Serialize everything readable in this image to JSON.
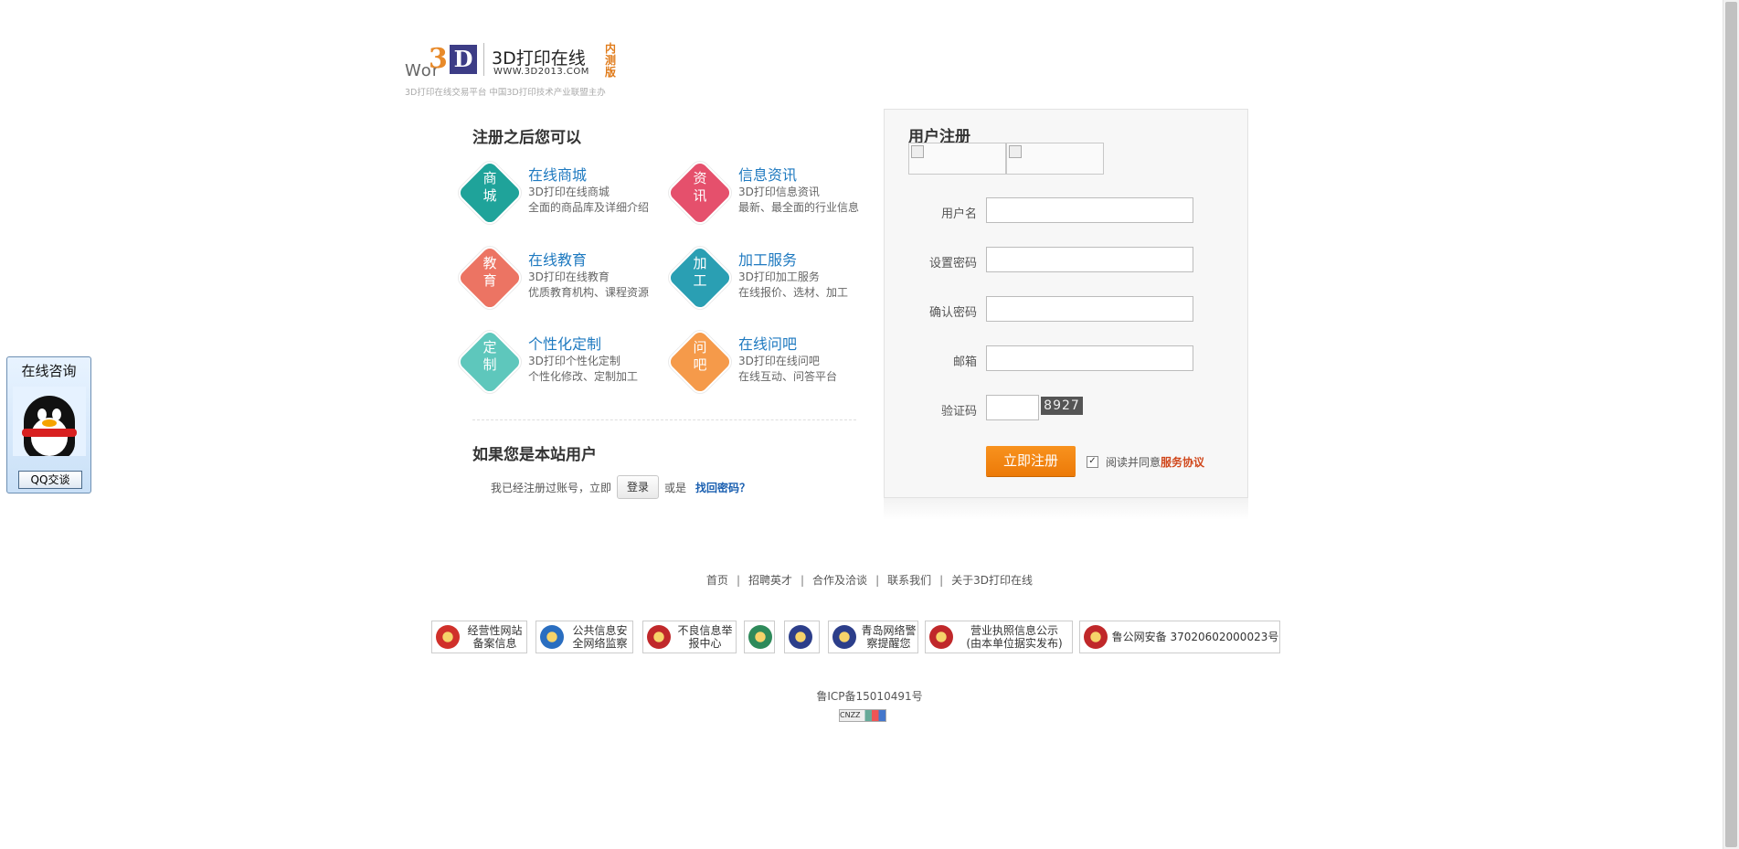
{
  "logo": {
    "wor_text": "Wor",
    "three": "3",
    "d_letter": "D",
    "name": "3D打印在线",
    "url": "WWW.3D2013.COM",
    "beta": "内测版",
    "tagline": "3D打印在线交易平台  中国3D打印技术产业联盟主办"
  },
  "benefits": {
    "title": "注册之后您可以",
    "items": [
      {
        "badge": "商城",
        "title": "在线商城",
        "line1": "3D打印在线商城",
        "line2": "全面的商品库及详细介绍",
        "color": "#1fa39a"
      },
      {
        "badge": "资讯",
        "title": "信息资讯",
        "line1": "3D打印信息资讯",
        "line2": "最新、最全面的行业信息",
        "color": "#e5506c"
      },
      {
        "badge": "教育",
        "title": "在线教育",
        "line1": "3D打印在线教育",
        "line2": "优质教育机构、课程资源",
        "color": "#ec7463"
      },
      {
        "badge": "加工",
        "title": "加工服务",
        "line1": "3D打印加工服务",
        "line2": "在线报价、选材、加工",
        "color": "#2a9fb3"
      },
      {
        "badge": "定制",
        "title": "个性化定制",
        "line1": "3D打印个性化定制",
        "line2": "个性化修改、定制加工",
        "color": "#5ec7bc"
      },
      {
        "badge": "问吧",
        "title": "在线问吧",
        "line1": "3D打印在线问吧",
        "line2": "在线互动、问答平台",
        "color": "#f59a4a"
      }
    ]
  },
  "existing_user": {
    "title": "如果您是本站用户",
    "prefix": "我已经注册过账号，立即",
    "login_button": "登录",
    "or": "或是",
    "forgot": "找回密码？"
  },
  "register": {
    "title": "用户注册",
    "fields": [
      {
        "label": "用户名",
        "value": ""
      },
      {
        "label": "设置密码",
        "value": ""
      },
      {
        "label": "确认密码",
        "value": ""
      },
      {
        "label": "邮箱",
        "value": ""
      }
    ],
    "captcha_label": "验证码",
    "captcha_value": "",
    "captcha_code": "8927",
    "submit": "立即注册",
    "agree_prefix": "阅读并同意",
    "agree_link": "服务协议",
    "agree_checked": true
  },
  "footer": {
    "links": [
      "首页",
      "招聘英才",
      "合作及洽谈",
      "联系我们",
      "关于3D打印在线"
    ],
    "separator": "|",
    "badges": [
      {
        "text": "经营性网站\n备案信息",
        "color": "#d0302a"
      },
      {
        "text": "公共信息安\n全网络监察",
        "color": "#2a6ec0"
      },
      {
        "text": "不良信息举\n报中心",
        "color": "#c0282a"
      },
      {
        "text": "",
        "color": "#2e8a5a"
      },
      {
        "text": "",
        "color": "#2c3e8a"
      },
      {
        "text": "青岛网络警\n察提醒您",
        "color": "#2c3e8a"
      },
      {
        "text": "营业执照信息公示\n(由本单位据实发布)",
        "color": "#c0282a"
      },
      {
        "text": "鲁公网安备  37020602000023号",
        "color": "#c0282a"
      }
    ],
    "icp": "鲁ICP备15010491号",
    "cnzz": "CNZZ"
  },
  "qq": {
    "title": "在线咨询",
    "button": "QQ交谈"
  }
}
